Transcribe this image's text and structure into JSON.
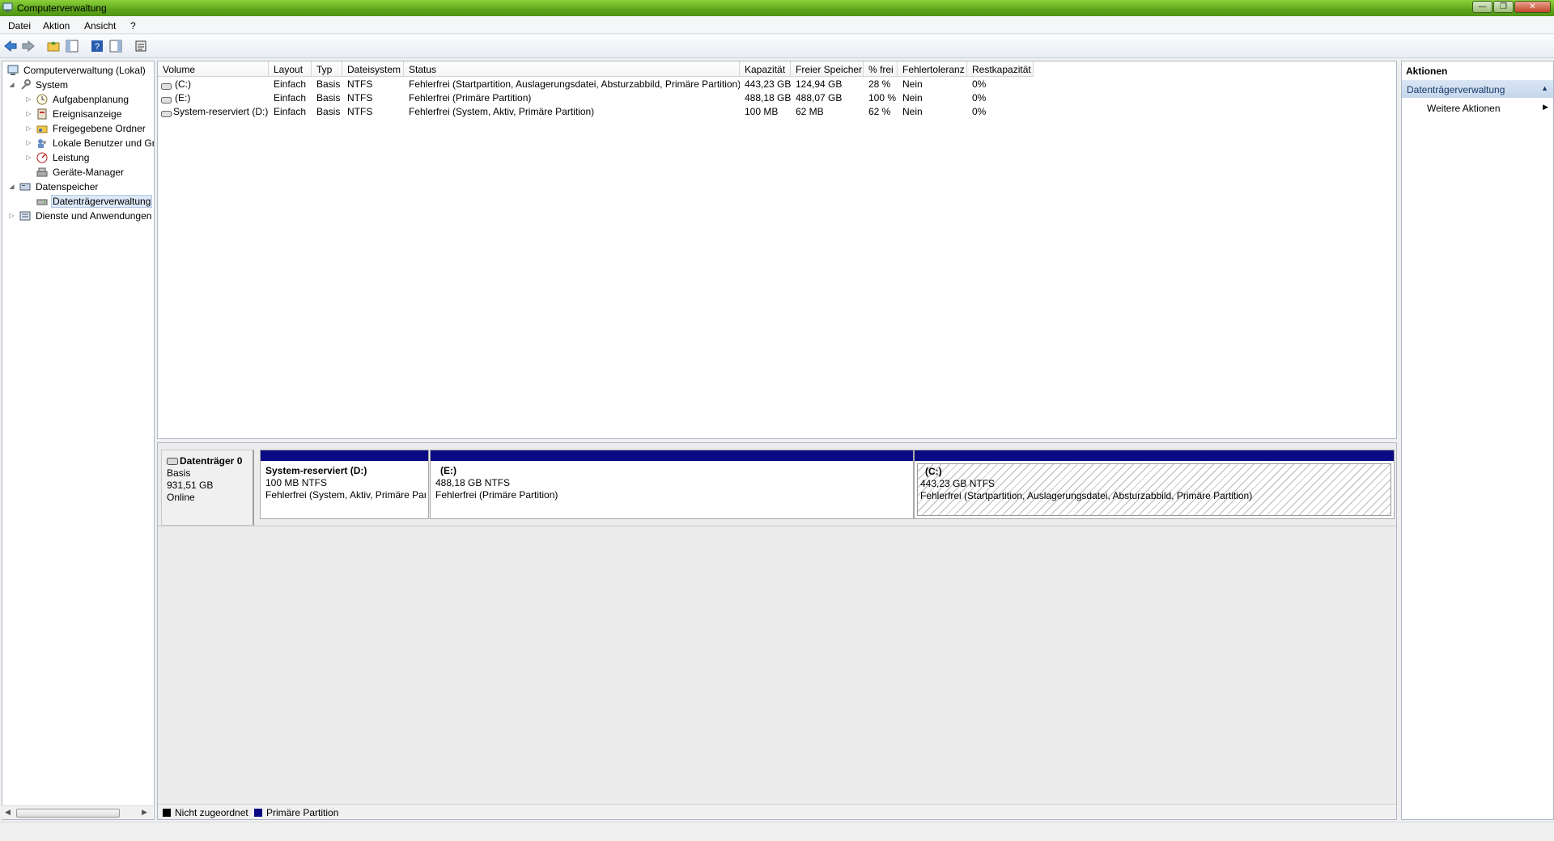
{
  "window": {
    "title": "Computerverwaltung",
    "controls": [
      "—",
      "❐",
      "✕"
    ]
  },
  "menu": [
    "Datei",
    "Aktion",
    "Ansicht",
    "?"
  ],
  "toolbar": {
    "buttons": [
      "back-arrow-icon",
      "forward-arrow-icon",
      "up-folder-icon",
      "show-hide-tree-icon",
      "help-icon",
      "show-hide-action-pane-icon",
      "properties-icon"
    ]
  },
  "tree": {
    "items": [
      {
        "label": "Computerverwaltung (Lokal)",
        "icon": "computer-management-icon",
        "expander": ""
      },
      {
        "label": "System",
        "icon": "tools-icon",
        "expander": "◢"
      },
      {
        "label": "Aufgabenplanung",
        "icon": "clock-icon",
        "expander": "▷"
      },
      {
        "label": "Ereignisanzeige",
        "icon": "event-viewer-icon",
        "expander": "▷"
      },
      {
        "label": "Freigegebene Ordner",
        "icon": "shared-folder-icon",
        "expander": "▷"
      },
      {
        "label": "Lokale Benutzer und Gr",
        "icon": "users-icon",
        "expander": "▷"
      },
      {
        "label": "Leistung",
        "icon": "performance-icon",
        "expander": "▷"
      },
      {
        "label": "Geräte-Manager",
        "icon": "device-manager-icon",
        "expander": ""
      },
      {
        "label": "Datenspeicher",
        "icon": "storage-icon",
        "expander": "◢"
      },
      {
        "label": "Datenträgerverwaltung",
        "icon": "disk-management-icon",
        "expander": ""
      },
      {
        "label": "Dienste und Anwendungen",
        "icon": "services-icon",
        "expander": "▷"
      }
    ]
  },
  "table": {
    "columns": [
      "Volume",
      "Layout",
      "Typ",
      "Dateisystem",
      "Status",
      "Kapazität",
      "Freier Speicher",
      "% frei",
      "Fehlertoleranz",
      "Restkapazität"
    ],
    "rows": [
      [
        "(C:)",
        "Einfach",
        "Basis",
        "NTFS",
        "Fehlerfrei (Startpartition, Auslagerungsdatei, Absturzabbild, Primäre Partition)",
        "443,23 GB",
        "124,94 GB",
        "28 %",
        "Nein",
        "0%"
      ],
      [
        "(E:)",
        "Einfach",
        "Basis",
        "NTFS",
        "Fehlerfrei (Primäre Partition)",
        "488,18 GB",
        "488,07 GB",
        "100 %",
        "Nein",
        "0%"
      ],
      [
        "System-reserviert (D:)",
        "Einfach",
        "Basis",
        "NTFS",
        "Fehlerfrei (System, Aktiv, Primäre Partition)",
        "100 MB",
        "62 MB",
        "62 %",
        "Nein",
        "0%"
      ]
    ]
  },
  "disk": {
    "name": "Datenträger 0",
    "type": "Basis",
    "size": "931,51 GB",
    "state": "Online",
    "partitions": [
      {
        "name": "System-reserviert  (D:)",
        "size": "100 MB NTFS",
        "status": "Fehlerfrei (System, Aktiv, Primäre Partition)"
      },
      {
        "name": "(E:)",
        "size": "488,18 GB NTFS",
        "status": "Fehlerfrei (Primäre Partition)"
      },
      {
        "name": "(C:)",
        "size": "443,23 GB NTFS",
        "status": "Fehlerfrei (Startpartition, Auslagerungsdatei, Absturzabbild, Primäre Partition)"
      }
    ]
  },
  "legend": [
    {
      "label": "Nicht zugeordnet",
      "color": "#000000"
    },
    {
      "label": "Primäre Partition",
      "color": "#0a0a84"
    }
  ],
  "actions": {
    "header": "Aktionen",
    "section": "Datenträgerverwaltung",
    "item": "Weitere Aktionen"
  },
  "colors": {
    "titlebar": "#5fa51c",
    "primary_partition": "#0a0a84",
    "selection": "#dde8f6"
  }
}
